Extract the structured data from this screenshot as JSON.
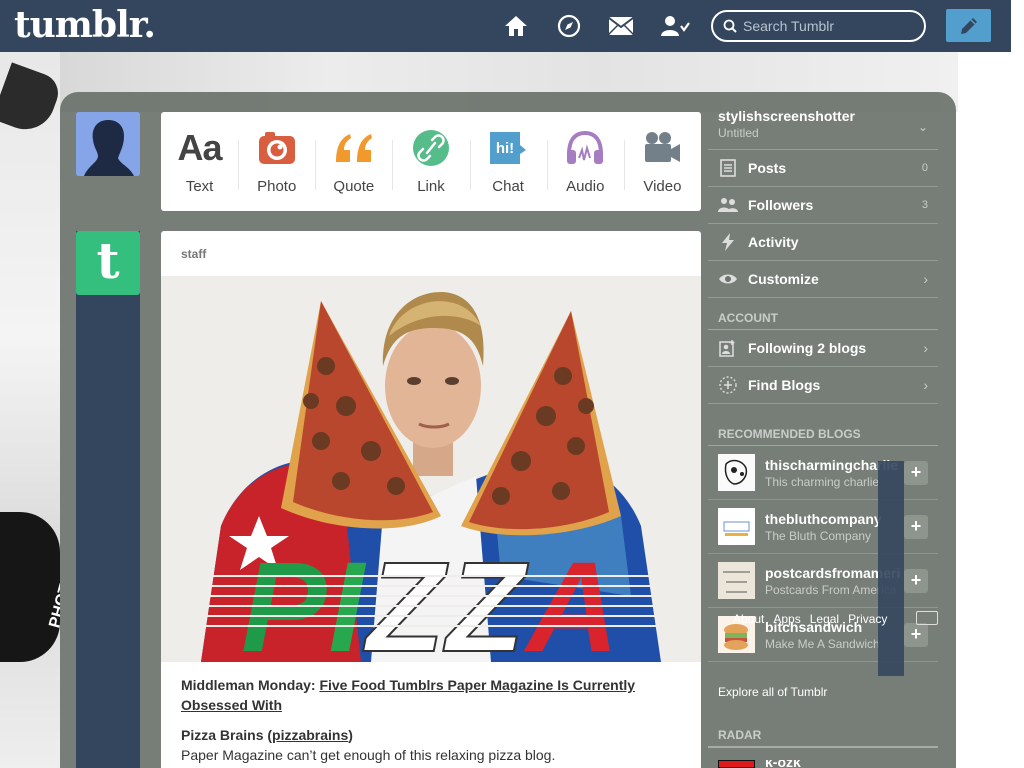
{
  "header": {
    "logo": "tumblr.",
    "search_placeholder": "Search Tumblr"
  },
  "post_types": [
    {
      "label": "Text",
      "icon": "text-icon",
      "color": "#444444"
    },
    {
      "label": "Photo",
      "icon": "camera-icon",
      "color": "#d95e40"
    },
    {
      "label": "Quote",
      "icon": "quote-icon",
      "color": "#f2992e"
    },
    {
      "label": "Link",
      "icon": "link-icon",
      "color": "#56bc8a"
    },
    {
      "label": "Chat",
      "icon": "chat-icon",
      "color": "#529ecc"
    },
    {
      "label": "Audio",
      "icon": "headphones-icon",
      "color": "#a77dc2"
    },
    {
      "label": "Video",
      "icon": "video-camera-icon",
      "color": "#748089"
    }
  ],
  "post": {
    "author": "staff",
    "image_text": "PIZZA",
    "title_prefix": "Middleman Monday: ",
    "title_link": "Five Food Tumblrs Paper Magazine Is Currently Obsessed With",
    "sub_name": "Pizza Brains (",
    "sub_link": "pizzabrains",
    "sub_close": ")",
    "sub_text": "Paper Magazine can’t get enough of this relaxing pizza blog."
  },
  "sidebar": {
    "blog_name": "stylishscreenshotter",
    "blog_title": "Untitled",
    "items": [
      {
        "label": "Posts",
        "count": "0"
      },
      {
        "label": "Followers",
        "count": "3"
      },
      {
        "label": "Activity"
      },
      {
        "label": "Customize"
      }
    ],
    "account_title": "ACCOUNT",
    "account_items": [
      {
        "label": "Following 2 blogs"
      },
      {
        "label": "Find Blogs"
      }
    ],
    "recommended_title": "RECOMMENDED BLOGS",
    "recommended": [
      {
        "name": "thischarmingcharlie",
        "sub": "This charming charlie"
      },
      {
        "name": "thebluthcompany",
        "sub": "The Bluth Company"
      },
      {
        "name": "postcardsfromamerica",
        "sub": "Postcards From America"
      },
      {
        "name": "bitchsandwich",
        "sub": "Make Me A Sandwich"
      }
    ],
    "footer_links": [
      "About",
      "Apps",
      "Legal",
      "Privacy"
    ],
    "explore": "Explore all of Tumblr",
    "radar_title": "RADAR",
    "radar_name": "k-ozk"
  },
  "background": {
    "photo_studio": "PHOTO STUDIO"
  },
  "colors": {
    "header": "#34465d",
    "accent": "#529ecc",
    "staff_avatar": "#35bf7f"
  }
}
